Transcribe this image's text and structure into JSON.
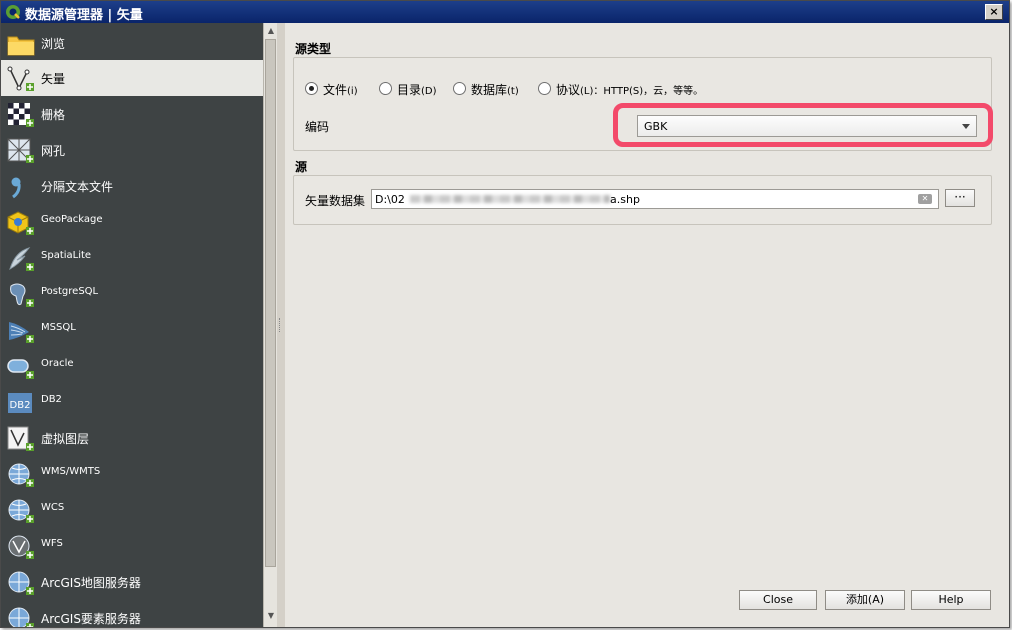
{
  "window": {
    "title": "数据源管理器 | 矢量",
    "close_glyph": "×"
  },
  "sidebar": {
    "items": [
      {
        "label": "浏览",
        "icon": "folder-icon"
      },
      {
        "label": "矢量",
        "icon": "vector-icon",
        "selected": true
      },
      {
        "label": "栅格",
        "icon": "raster-icon"
      },
      {
        "label": "网孔",
        "icon": "mesh-icon"
      },
      {
        "label": "分隔文本文件",
        "icon": "delimited-text-icon"
      },
      {
        "label": "GeoPackage",
        "icon": "geopackage-icon"
      },
      {
        "label": "SpatiaLite",
        "icon": "spatialite-icon"
      },
      {
        "label": "PostgreSQL",
        "icon": "postgresql-icon"
      },
      {
        "label": "MSSQL",
        "icon": "mssql-icon"
      },
      {
        "label": "Oracle",
        "icon": "oracle-icon"
      },
      {
        "label": "DB2",
        "icon": "db2-icon"
      },
      {
        "label": "虚拟图层",
        "icon": "virtual-layer-icon"
      },
      {
        "label": "WMS/WMTS",
        "icon": "wms-icon"
      },
      {
        "label": "WCS",
        "icon": "wcs-icon"
      },
      {
        "label": "WFS",
        "icon": "wfs-icon"
      },
      {
        "label": "ArcGIS地图服务器",
        "icon": "arcgis-map-icon"
      },
      {
        "label": "ArcGIS要素服务器",
        "icon": "arcgis-feature-icon"
      }
    ]
  },
  "source_type": {
    "title": "源类型",
    "options": [
      {
        "label": "文件",
        "shortcut": "(i)",
        "selected": true
      },
      {
        "label": "目录",
        "shortcut": "(D)",
        "selected": false
      },
      {
        "label": "数据库",
        "shortcut": "(t)",
        "selected": false
      },
      {
        "label": "协议",
        "shortcut": "(L)",
        "selected": false
      }
    ],
    "protocol_suffix": "：HTTP(S)，云，等等。",
    "encoding_label": "编码",
    "encoding_value": "GBK"
  },
  "source": {
    "title": "源",
    "dataset_label": "矢量数据集",
    "path_prefix": "D:\\02",
    "path_suffix": "a.shp",
    "browse_label": "···"
  },
  "buttons": {
    "close": "Close",
    "add": "添加(A)",
    "help": "Help"
  },
  "colors": {
    "highlight": "#f34a6a",
    "sidebar_bg": "#3e4344",
    "title_bar": "#0a246a"
  }
}
